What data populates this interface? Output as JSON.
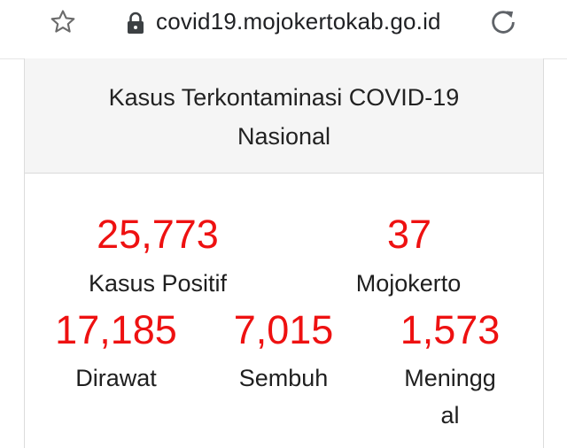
{
  "browser": {
    "url": "covid19.mojokertokab.go.id",
    "icons": [
      "star-icon",
      "lock-icon",
      "reload-icon"
    ]
  },
  "card": {
    "title_line1": "Kasus Terkontaminasi COVID-19",
    "title_line2": "Nasional"
  },
  "stats": {
    "positif": {
      "value": "25,773",
      "label": "Kasus Positif"
    },
    "mojokerto": {
      "value": "37",
      "label": "Mojokerto"
    },
    "dirawat": {
      "value": "17,185",
      "label": "Dirawat"
    },
    "sembuh": {
      "value": "7,015",
      "label": "Sembuh"
    },
    "meninggal": {
      "value": "1,573",
      "label_line1": "Meningg",
      "label_line2": "al"
    }
  },
  "colors": {
    "number_red": "#ee1111",
    "header_bg": "#f5f5f5"
  }
}
